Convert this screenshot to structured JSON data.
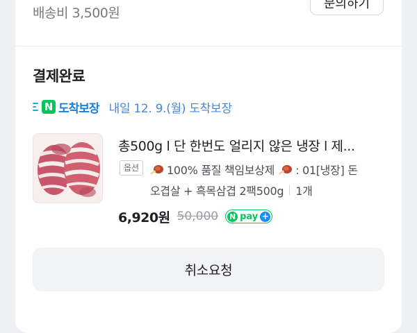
{
  "shipping": {
    "fee_label": "배송비 3,500원"
  },
  "top_button": {
    "label": "문의하기"
  },
  "order": {
    "status_title": "결제완료",
    "delivery_badge": {
      "n_letter": "N",
      "label": "도착보장"
    },
    "delivery_text": "내일 12. 9.(월) 도착보장",
    "product": {
      "name": "총500g l 단 한번도 얼리지 않은 냉장 l 제...",
      "option_tag": "옵션",
      "option_line1": "100% 품질 책임보상제",
      "option_line1_suffix": ": 01[냉장] 돈",
      "option_line2": "오겹살 + 흑목삼겹 2팩500g",
      "quantity": "1개",
      "price": "6,920원",
      "original_price": "50,000",
      "npay": {
        "n_letter": "N",
        "label": "pay",
        "plus": "+"
      }
    },
    "cancel_label": "취소요청"
  },
  "colors": {
    "accent_blue": "#4a86d6",
    "naver_green": "#03c75a",
    "badge_blue": "#1a7fd9"
  }
}
